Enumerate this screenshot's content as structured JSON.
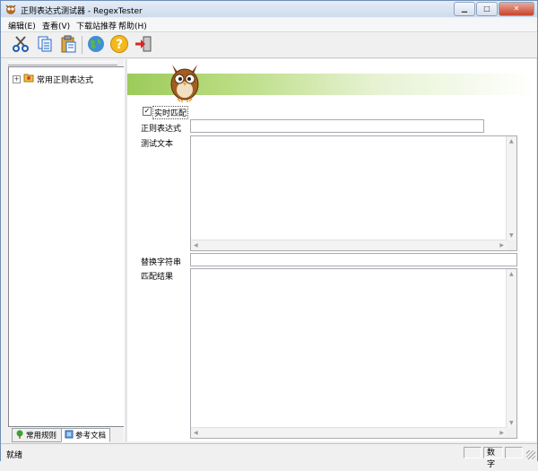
{
  "window": {
    "title": "正则表达式测试器 - RegexTester"
  },
  "menu": [
    "编辑(E)",
    "查看(V)",
    "下载站推荐",
    "帮助(H)"
  ],
  "toolbar_icons": [
    "cut-icon",
    "copy-icon",
    "paste-icon",
    "globe-icon",
    "help-icon",
    "exit-icon"
  ],
  "tree": {
    "items": [
      {
        "label": "常用正则表达式",
        "expander": "+"
      }
    ]
  },
  "tabs": {
    "common_rules": "常用规则",
    "reference_docs": "参考文档"
  },
  "form": {
    "realtime_match_label": "实时匹配",
    "realtime_match_checked": true,
    "regex_label": "正则表达式",
    "regex_value": "",
    "test_text_label": "测试文本",
    "test_text_value": "",
    "replace_label": "替换字符串",
    "replace_value": "",
    "result_label": "匹配结果",
    "result_value": ""
  },
  "status": {
    "message": "就绪",
    "mode": "数字"
  },
  "colors": {
    "banner_green": "#9ccb5a",
    "title_bar": "#dbe6f4"
  }
}
